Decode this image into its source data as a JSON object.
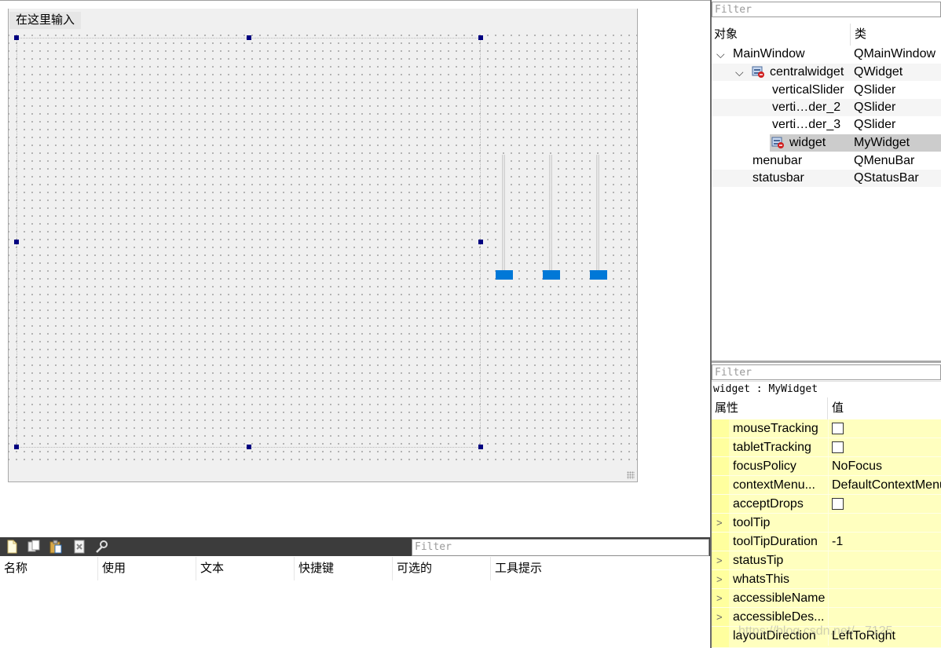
{
  "form": {
    "menu_placeholder": "在这里输入"
  },
  "action_editor": {
    "filter_placeholder": "Filter",
    "toolbar_icons": [
      "new-action-icon",
      "copy-action-icon",
      "paste-action-icon",
      "delete-action-icon",
      "configure-icon"
    ],
    "columns": [
      "名称",
      "使用",
      "文本",
      "快捷键",
      "可选的",
      "工具提示"
    ]
  },
  "object_inspector": {
    "filter_placeholder": "Filter",
    "header": {
      "object": "对象",
      "class": "类"
    },
    "rows": [
      {
        "name": "MainWindow",
        "class": "QMainWindow"
      },
      {
        "name": "centralwidget",
        "class": "QWidget"
      },
      {
        "name": "verticalSlider",
        "class": "QSlider"
      },
      {
        "name": "verti…der_2",
        "class": "QSlider"
      },
      {
        "name": "verti…der_3",
        "class": "QSlider"
      },
      {
        "name": "widget",
        "class": "MyWidget"
      },
      {
        "name": "menubar",
        "class": "QMenuBar"
      },
      {
        "name": "statusbar",
        "class": "QStatusBar"
      }
    ]
  },
  "property_editor": {
    "filter_placeholder": "Filter",
    "object_label": "widget : MyWidget",
    "header": {
      "property": "属性",
      "value": "值"
    },
    "rows": [
      {
        "name": "mouseTracking",
        "value": ""
      },
      {
        "name": "tabletTracking",
        "value": ""
      },
      {
        "name": "focusPolicy",
        "value": "NoFocus"
      },
      {
        "name": "contextMenu...",
        "value": "DefaultContextMenu"
      },
      {
        "name": "acceptDrops",
        "value": ""
      },
      {
        "name": "toolTip",
        "value": ""
      },
      {
        "name": "toolTipDuration",
        "value": "-1"
      },
      {
        "name": "statusTip",
        "value": ""
      },
      {
        "name": "whatsThis",
        "value": ""
      },
      {
        "name": "accessibleName",
        "value": ""
      },
      {
        "name": "accessibleDes...",
        "value": ""
      },
      {
        "name": "layoutDirection",
        "value": "LeftToRight"
      }
    ]
  },
  "watermark": "https://blog.csdn.net/...7125",
  "colors": {
    "accent": "#0078d7",
    "selection_handle": "#000080",
    "property_row": "#ffffbf",
    "toolbar": "#3c3c3c"
  }
}
